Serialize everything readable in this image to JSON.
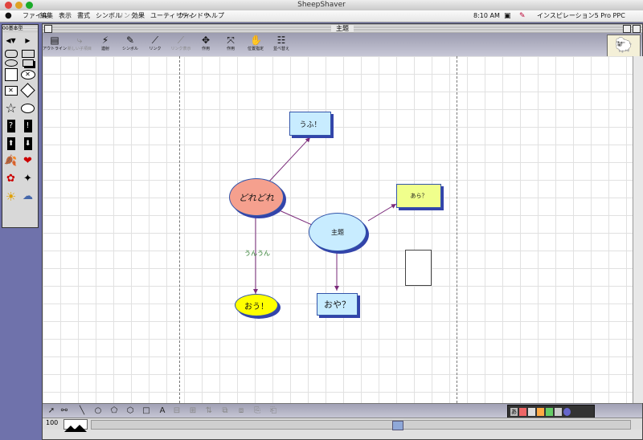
{
  "host": {
    "title": "SheepShaver"
  },
  "menubar": {
    "apple": "",
    "items": [
      "ファイル",
      "編集",
      "表示",
      "書式",
      "シンボル",
      "リンク",
      "効果",
      "ユーティリティ",
      "ウィンドウ",
      "ヘルプ"
    ],
    "clock": "8:10 AM",
    "app_name": "インスピレーション5 Pro PPC"
  },
  "palette": {
    "title": "00基本型"
  },
  "document": {
    "title": "主題"
  },
  "toolbar": {
    "tools": [
      {
        "label": "アウトライン",
        "icon": "outline-icon",
        "dim": false
      },
      {
        "label": "新しい子項目",
        "icon": "new-child-icon",
        "dim": true
      },
      {
        "label": "連射",
        "icon": "rapidfire-icon",
        "dim": false
      },
      {
        "label": "シンボル",
        "icon": "symbol-icon",
        "dim": false
      },
      {
        "label": "リンク",
        "icon": "link-icon",
        "dim": false
      },
      {
        "label": "リンク表示",
        "icon": "link-show-icon",
        "dim": true
      },
      {
        "label": "作用",
        "icon": "move-icon",
        "dim": false
      },
      {
        "label": "作用",
        "icon": "fit-icon",
        "dim": false
      },
      {
        "label": "位置指定",
        "icon": "hand-icon",
        "dim": false
      },
      {
        "label": "並べ替え",
        "icon": "arrange-icon",
        "dim": false
      }
    ]
  },
  "diagram": {
    "nodes": {
      "main": "主題",
      "doredore": "どれどれ",
      "ufu": "うふ！",
      "ara": "あら？",
      "ou": "おう！",
      "oya": "おや？",
      "link_label": "うんうん"
    },
    "colors": {
      "main": "#c8ecff",
      "doredore": "#f5a08e",
      "ufu": "#c8ecff",
      "ara": "#f0ff8c",
      "ou": "#ffff00",
      "oya": "#c8ecff",
      "link": "#7a2a7a",
      "link_label": "#2a7a2a"
    }
  },
  "status": {
    "zoom": "100"
  }
}
